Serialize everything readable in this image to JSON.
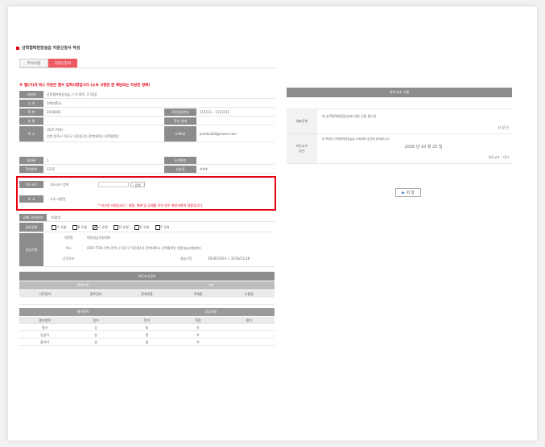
{
  "page": {
    "title": "산학협력현장실습 지원신청서 작성",
    "tabs": [
      {
        "label": "주의사항",
        "active": false
      },
      {
        "label": "지원신청서",
        "active": true
      }
    ],
    "notice": "※ 별(가)의 박스 부분은 필수 입력사항입니다 (소속 사항만 문 해당되는 작성한 정확)",
    "accent_color": "#e60012",
    "tab_active_color": "#ee5a62",
    "header_gray": "#8c8c8c"
  },
  "form": {
    "rows": [
      {
        "label": "과정명",
        "value": "산학협력현장실습 I / II (6주, 3 학점)"
      },
      {
        "label": "소 속",
        "value": "전북대학교"
      },
      {
        "label": "학 번",
        "value": "2016001",
        "label2": "주민등록번호",
        "value2": "111111 - 1111111"
      },
      {
        "label": "성 명",
        "value": "",
        "label2": "학년 상태",
        "value2": ""
      },
      {
        "label": "주 소",
        "value": "(567-759)",
        "value_b": "전북 전주시 덕진구 덕진동1가 전북대학교 산학협력단",
        "label2": "E-Mail",
        "value2": "jeonbuk00@naver.com"
      },
      {
        "label": "휴대폰",
        "value": "1",
        "label2": "유선번호",
        "value2": ""
      },
      {
        "label": "학부번호",
        "value": "1221",
        "label2": "신분증",
        "value2": "###"
      }
    ],
    "redbox": {
      "advisor_label": "지도교수",
      "advisor_sublabel": "지도교수 검색",
      "search_button": "검색",
      "note_label": "비 고",
      "note_sublabel": "소속 사항란",
      "note_text": "* 비고란 사항입니다 : 결정, 해외 및 공채를 모두 연수 위한사항의 내용입니다."
    },
    "field_label": "UNC 전처리기",
    "field_value": "미정의",
    "type_label": "실습유형",
    "types": [
      {
        "label": "A 유형",
        "checked": false
      },
      {
        "label": "B 유형",
        "checked": false
      },
      {
        "label": "C 유형",
        "checked": true
      },
      {
        "label": "D 유형",
        "checked": false
      },
      {
        "label": "E 유형",
        "checked": false
      },
      {
        "label": "F 유형",
        "checked": false
      }
    ],
    "org": {
      "label": "실습기관",
      "name_label": "기관명",
      "name_value": "현장실습지원센터",
      "addr_label": "주소",
      "addr_value": "(567-759) 전북 전주시 덕진구 덕진동1가 전북대학교 산학협력단 현장실습지원센터",
      "dept_label": "근무부서",
      "dept_value": "",
      "period_label": "실습기간",
      "period_value": "2016/10/24 ~ 2016/11/18"
    },
    "section2_title": "지도교수정보",
    "section2_sub": [
      "관계사항",
      "기타"
    ],
    "section2_cols": [
      "시작일자",
      "종료일자",
      "관계내용",
      "주제명",
      "시험명"
    ],
    "section3_sub": [
      "평가항목",
      "점검사항"
    ],
    "section3_cols": [
      "평가항목",
      "점수",
      "학기",
      "학점",
      "평가"
    ],
    "section3_rows": [
      [
        "평가",
        "상",
        "중",
        "하",
        ""
      ],
      [
        "입상이",
        "상",
        "중",
        "하",
        ""
      ],
      [
        "출석이",
        "상",
        "중",
        "하",
        ""
      ]
    ]
  },
  "right": {
    "header": "지역 보조 기술",
    "rows": [
      {
        "label": "대표문희",
        "text": "위 산학협력현장실습에 지원 신청 합니다.",
        "sign": "신 청 인"
      },
      {
        "label": "지도교수\n승인",
        "text": "위 학생의 산학협력현장실습 교육계획 승인에 동의합니다.",
        "date": "2016 년  10 월  25 일",
        "sign": "지도교수 : (인)"
      }
    ],
    "submit_button": "저 장"
  }
}
